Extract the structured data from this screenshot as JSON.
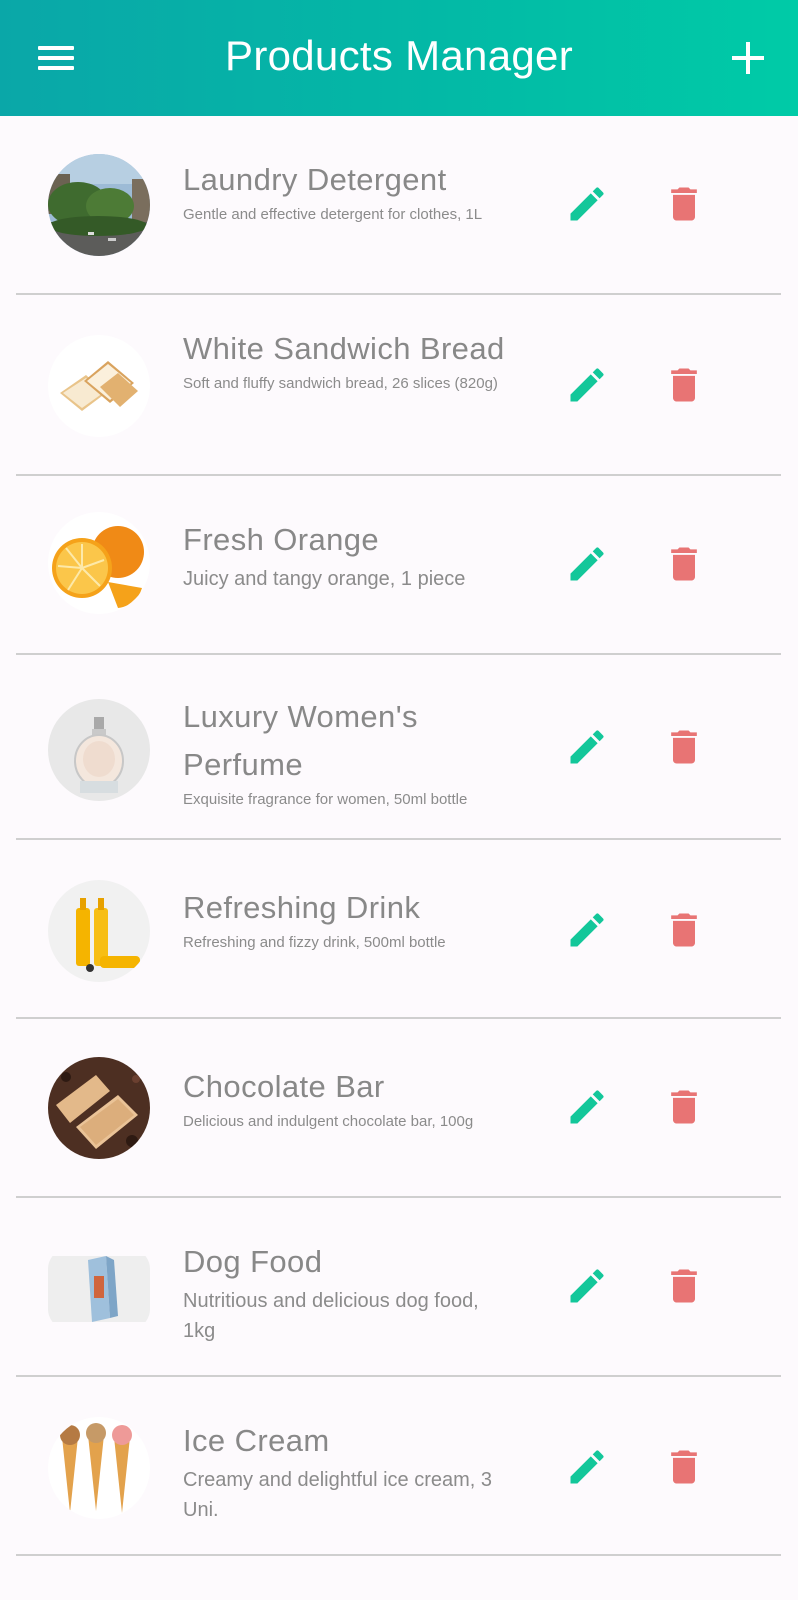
{
  "header": {
    "title": "Products Manager",
    "menu_icon": "hamburger-menu-icon",
    "add_icon": "plus-icon",
    "gradient_start": "#0aa7a8",
    "gradient_end": "#00cba7"
  },
  "colors": {
    "edit_icon": "#13c79a",
    "delete_icon": "#e87474",
    "text": "#888888",
    "divider": "#cfcfcf"
  },
  "products": [
    {
      "name": "Laundry Detergent",
      "description": "Gentle and effective detergent for clothes, 1L",
      "image": "street-photo"
    },
    {
      "name": "White Sandwich Bread",
      "description": "Soft and fluffy sandwich bread, 26 slices (820g)",
      "image": "bread-slices"
    },
    {
      "name": "Fresh Orange",
      "description": "Juicy and tangy orange, 1 piece",
      "image": "oranges"
    },
    {
      "name": "Luxury Women's Perfume",
      "description": "Exquisite fragrance for women, 50ml bottle",
      "image": "perfume-bottle"
    },
    {
      "name": "Refreshing Drink",
      "description": "Refreshing and fizzy drink, 500ml bottle",
      "image": "drink-bottles"
    },
    {
      "name": "Chocolate Bar",
      "description": "Delicious and indulgent chocolate bar, 100g",
      "image": "chocolate-bars"
    },
    {
      "name": "Dog Food",
      "description": "Nutritious and delicious dog food, 1kg",
      "image": "dog-food-bag"
    },
    {
      "name": "Ice Cream",
      "description": "Creamy and delightful ice cream, 3 Uni.",
      "image": "ice-cream-cones"
    }
  ]
}
